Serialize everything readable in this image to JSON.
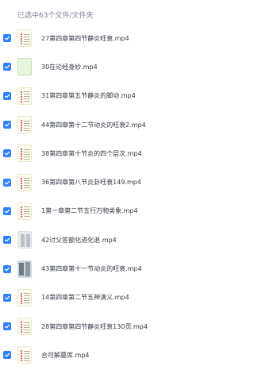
{
  "header": {
    "selection_text": "已选中63个文件/文件夹"
  },
  "files": [
    {
      "name": "27第四章第四节静炎旺衰.mp4",
      "thumb": "doc"
    },
    {
      "name": "30在论经身妙.mp4",
      "thumb": "green"
    },
    {
      "name": "31第四章第五节静炎的脚动.mp4",
      "thumb": "doc"
    },
    {
      "name": "44第四章第十二节动炎的旺衰2.mp4",
      "thumb": "doc"
    },
    {
      "name": "38第四章第十节炎的四个层次.mp4",
      "thumb": "doc"
    },
    {
      "name": "36第四章第八节炎卦旺衰149.mp4",
      "thumb": "doc"
    },
    {
      "name": "1第一章第二节五行万物类象.mp4",
      "thumb": "doc"
    },
    {
      "name": "42讨父答额化进化退.mp4",
      "thumb": "gray"
    },
    {
      "name": "43第四章第十一节动炎的旺衰.mp4",
      "thumb": "photo"
    },
    {
      "name": "14第四章第二节五神演义.mp4",
      "thumb": "doc"
    },
    {
      "name": "28第四章第四节静炎旺衰130页.mp4",
      "thumb": "doc"
    },
    {
      "name": "合可解墓库.mp4",
      "thumb": "doc"
    }
  ],
  "colors": {
    "checkbox": "#2f80ff",
    "header_text": "#7b8697",
    "file_text": "#333a44"
  },
  "icons": {
    "checkbox": "checkbox-checked-icon",
    "doc_thumb": "document-thumbnail-icon"
  }
}
